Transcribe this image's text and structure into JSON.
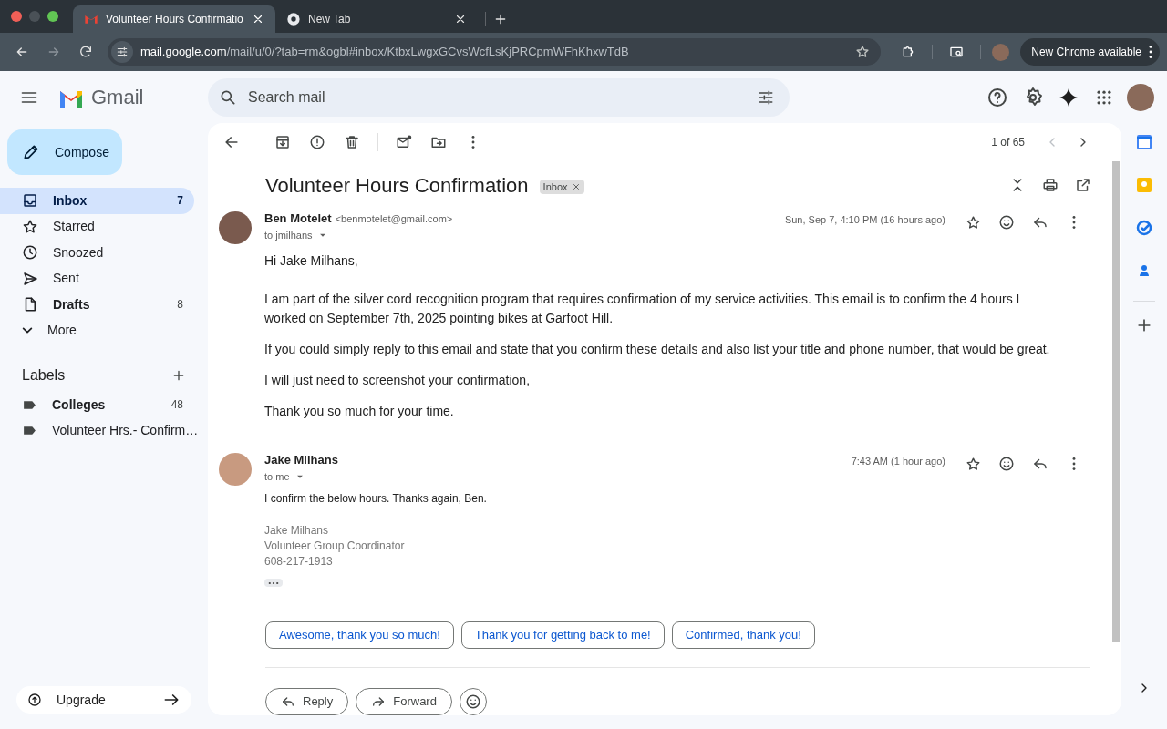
{
  "browser": {
    "tabs": [
      {
        "title": "Volunteer Hours Confirmatio",
        "selected": true
      },
      {
        "title": "New Tab",
        "selected": false
      }
    ],
    "url_host": "mail.google.com",
    "url_path": "/mail/u/0/?tab=rm&ogbl#inbox/KtbxLwgxGCvsWcfLsKjPRCpmWFhKhxwTdB",
    "update_button": "New Chrome available"
  },
  "header": {
    "app_name": "Gmail",
    "search": {
      "placeholder": "Search mail"
    }
  },
  "sidebar": {
    "compose": "Compose",
    "items": [
      {
        "label": "Inbox",
        "count": "7",
        "selected": true,
        "bold": true
      },
      {
        "label": "Starred",
        "selected": false,
        "bold": false
      },
      {
        "label": "Snoozed",
        "selected": false,
        "bold": false
      },
      {
        "label": "Sent",
        "selected": false,
        "bold": false
      },
      {
        "label": "Drafts",
        "count": "8",
        "selected": false,
        "bold": true
      },
      {
        "label": "More",
        "selected": false,
        "bold": false
      }
    ],
    "labels_heading": "Labels",
    "labels": [
      {
        "label": "Colleges",
        "count": "48",
        "bold": true
      },
      {
        "label": "Volunteer Hrs.- Confirm…",
        "bold": false
      }
    ],
    "upgrade": "Upgrade"
  },
  "thread": {
    "pager": "1 of 65",
    "subject": "Volunteer Hours Confirmation",
    "tag": "Inbox",
    "messages": [
      {
        "sender": "Ben Motelet",
        "email": "<benmotelet@gmail.com>",
        "to": "to jmilhans",
        "time": "Sun, Sep 7, 4:10 PM (16 hours ago)",
        "body": [
          "Hi Jake Milhans,",
          "I am part of the silver cord recognition program that requires confirmation of my service activities. This email is to confirm the 4 hours I worked on September 7th, 2025 pointing bikes at Garfoot Hill.",
          "If you could simply reply to this email and state that you confirm these details and also list your title and phone number, that would be great.",
          "I will just need to screenshot your confirmation,",
          "Thank you so much for your time."
        ]
      },
      {
        "sender": "Jake Milhans",
        "to": "to me",
        "time": "7:43 AM (1 hour ago)",
        "body": [
          "I confirm the below hours. Thanks again, Ben."
        ],
        "signature": [
          "Jake Milhans",
          "Volunteer Group Coordinator",
          "608-217-1913"
        ]
      }
    ],
    "smart_replies": [
      "Awesome, thank you so much!",
      "Thank you for getting back to me!",
      "Confirmed, thank you!"
    ],
    "actions": [
      "Reply",
      "Forward"
    ]
  }
}
